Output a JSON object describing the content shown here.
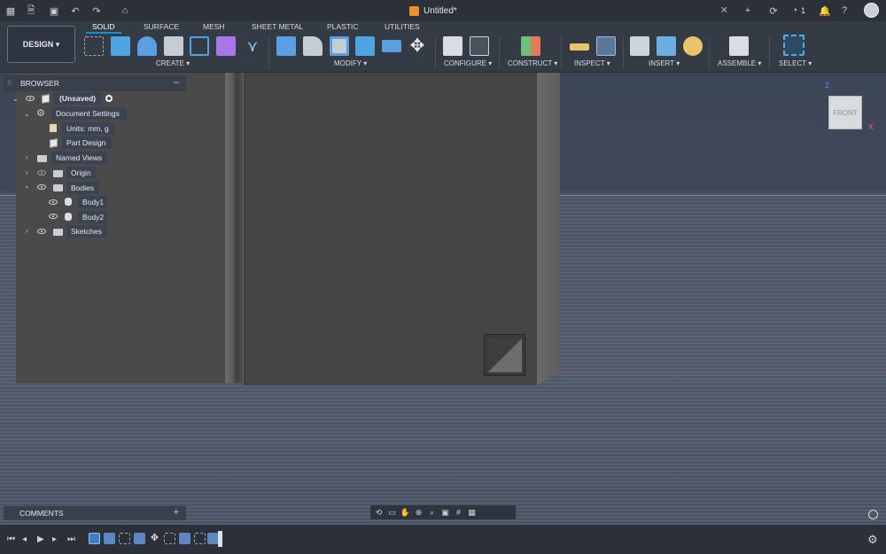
{
  "document": {
    "title": "Untitled*"
  },
  "workspace": {
    "label": "DESIGN ▾"
  },
  "tabs": [
    {
      "label": "SOLID",
      "active": true
    },
    {
      "label": "SURFACE"
    },
    {
      "label": "MESH"
    },
    {
      "label": "SHEET METAL"
    },
    {
      "label": "PLASTIC"
    },
    {
      "label": "UTILITIES"
    }
  ],
  "groups": {
    "create": "CREATE ▾",
    "modify": "MODIFY ▾",
    "configure": "CONFIGURE ▾",
    "construct": "CONSTRUCT ▾",
    "inspect": "INSPECT ▾",
    "insert": "INSERT ▾",
    "assemble": "ASSEMBLE ▾",
    "select": "SELECT ▾"
  },
  "topbar": {
    "jobs_count": "1"
  },
  "browser": {
    "title": "BROWSER",
    "root": "(Unsaved)",
    "items": [
      {
        "label": "Document Settings"
      },
      {
        "label": "Units: mm, g"
      },
      {
        "label": "Part Design"
      },
      {
        "label": "Named Views"
      },
      {
        "label": "Origin"
      },
      {
        "label": "Bodies"
      },
      {
        "label": "Body1"
      },
      {
        "label": "Body2"
      },
      {
        "label": "Sketches"
      }
    ]
  },
  "viewcube": {
    "face": "FRONT",
    "axis_z": "Z",
    "axis_x": "X"
  },
  "comments": {
    "title": "COMMENTS"
  },
  "icons": {
    "accent": "#0696d7",
    "body_color": "#4a4a4a"
  }
}
